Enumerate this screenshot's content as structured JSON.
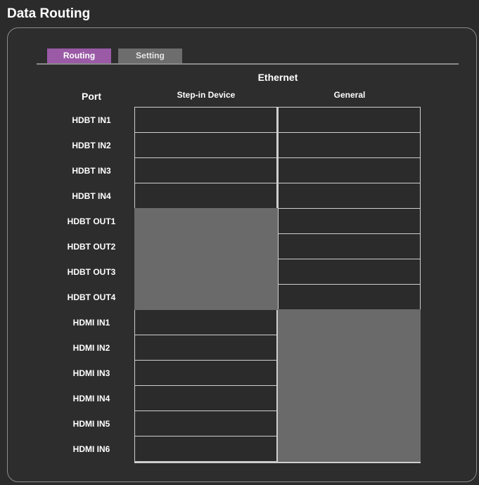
{
  "page": {
    "title": "Data Routing"
  },
  "tabs": [
    {
      "label": "Routing",
      "active": true
    },
    {
      "label": "Setting",
      "active": false
    }
  ],
  "table": {
    "group_header": "Ethernet",
    "port_header": "Port",
    "columns": [
      "Step-in Device",
      "General"
    ],
    "rows": [
      {
        "port": "HDBT IN1",
        "step_in_device": "available",
        "general": "available"
      },
      {
        "port": "HDBT IN2",
        "step_in_device": "available",
        "general": "available"
      },
      {
        "port": "HDBT IN3",
        "step_in_device": "available",
        "general": "available"
      },
      {
        "port": "HDBT IN4",
        "step_in_device": "available",
        "general": "available"
      },
      {
        "port": "HDBT OUT1",
        "step_in_device": "unavailable",
        "general": "available"
      },
      {
        "port": "HDBT OUT2",
        "step_in_device": "unavailable",
        "general": "available"
      },
      {
        "port": "HDBT OUT3",
        "step_in_device": "unavailable",
        "general": "available"
      },
      {
        "port": "HDBT OUT4",
        "step_in_device": "unavailable",
        "general": "available"
      },
      {
        "port": "HDMI IN1",
        "step_in_device": "available",
        "general": "unavailable"
      },
      {
        "port": "HDMI IN2",
        "step_in_device": "available",
        "general": "unavailable"
      },
      {
        "port": "HDMI IN3",
        "step_in_device": "available",
        "general": "unavailable"
      },
      {
        "port": "HDMI IN4",
        "step_in_device": "available",
        "general": "unavailable"
      },
      {
        "port": "HDMI IN5",
        "step_in_device": "available",
        "general": "unavailable"
      },
      {
        "port": "HDMI IN6",
        "step_in_device": "available",
        "general": "unavailable"
      }
    ]
  },
  "colors": {
    "background": "#2b2b2b",
    "active_tab": "#9a5aa6",
    "inactive_tab": "#6d6d6d",
    "grid_line": "#cfcfcf",
    "unavailable_cell": "#6a6a6a"
  }
}
